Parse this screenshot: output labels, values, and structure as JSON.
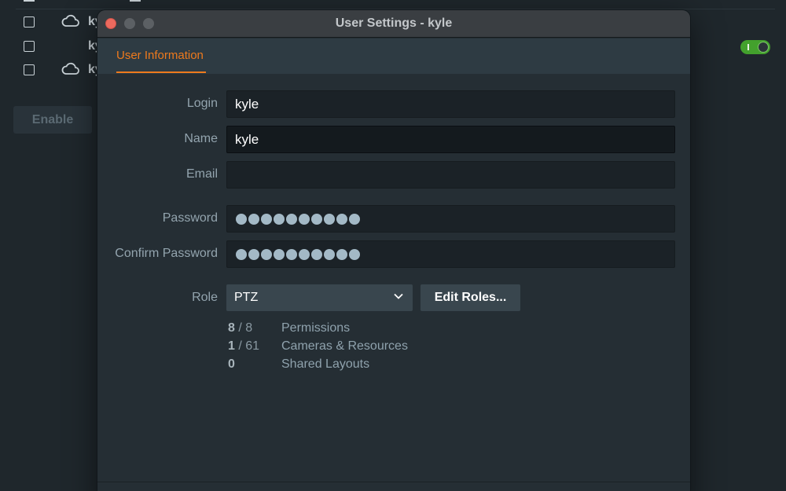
{
  "background": {
    "rows": [
      {
        "user": "ky",
        "has_cloud": true
      },
      {
        "user": "ky",
        "has_cloud": false
      },
      {
        "user": "ky",
        "has_cloud": true
      }
    ],
    "enable_button": "Enable",
    "toggle_state": "on"
  },
  "dialog": {
    "title": "User Settings - kyle",
    "tab": "User Information",
    "fields": {
      "login": {
        "label": "Login",
        "value": "kyle"
      },
      "name": {
        "label": "Name",
        "value": "kyle"
      },
      "email": {
        "label": "Email",
        "value": ""
      },
      "password": {
        "label": "Password",
        "masked_length": 10
      },
      "confirm_password": {
        "label": "Confirm Password",
        "masked_length": 10
      }
    },
    "role": {
      "label": "Role",
      "value": "PTZ",
      "edit_button": "Edit Roles..."
    },
    "stats": [
      {
        "current": "8",
        "total": "/ 8",
        "label": "Permissions"
      },
      {
        "current": "1",
        "total": "/ 61",
        "label": "Cameras & Resources"
      },
      {
        "current": "0",
        "total": "",
        "label": "Shared Layouts"
      }
    ]
  },
  "colors": {
    "accent": "#ee7a1d",
    "toggle_on": "#43a12d",
    "close_button": "#ec6a5e"
  }
}
